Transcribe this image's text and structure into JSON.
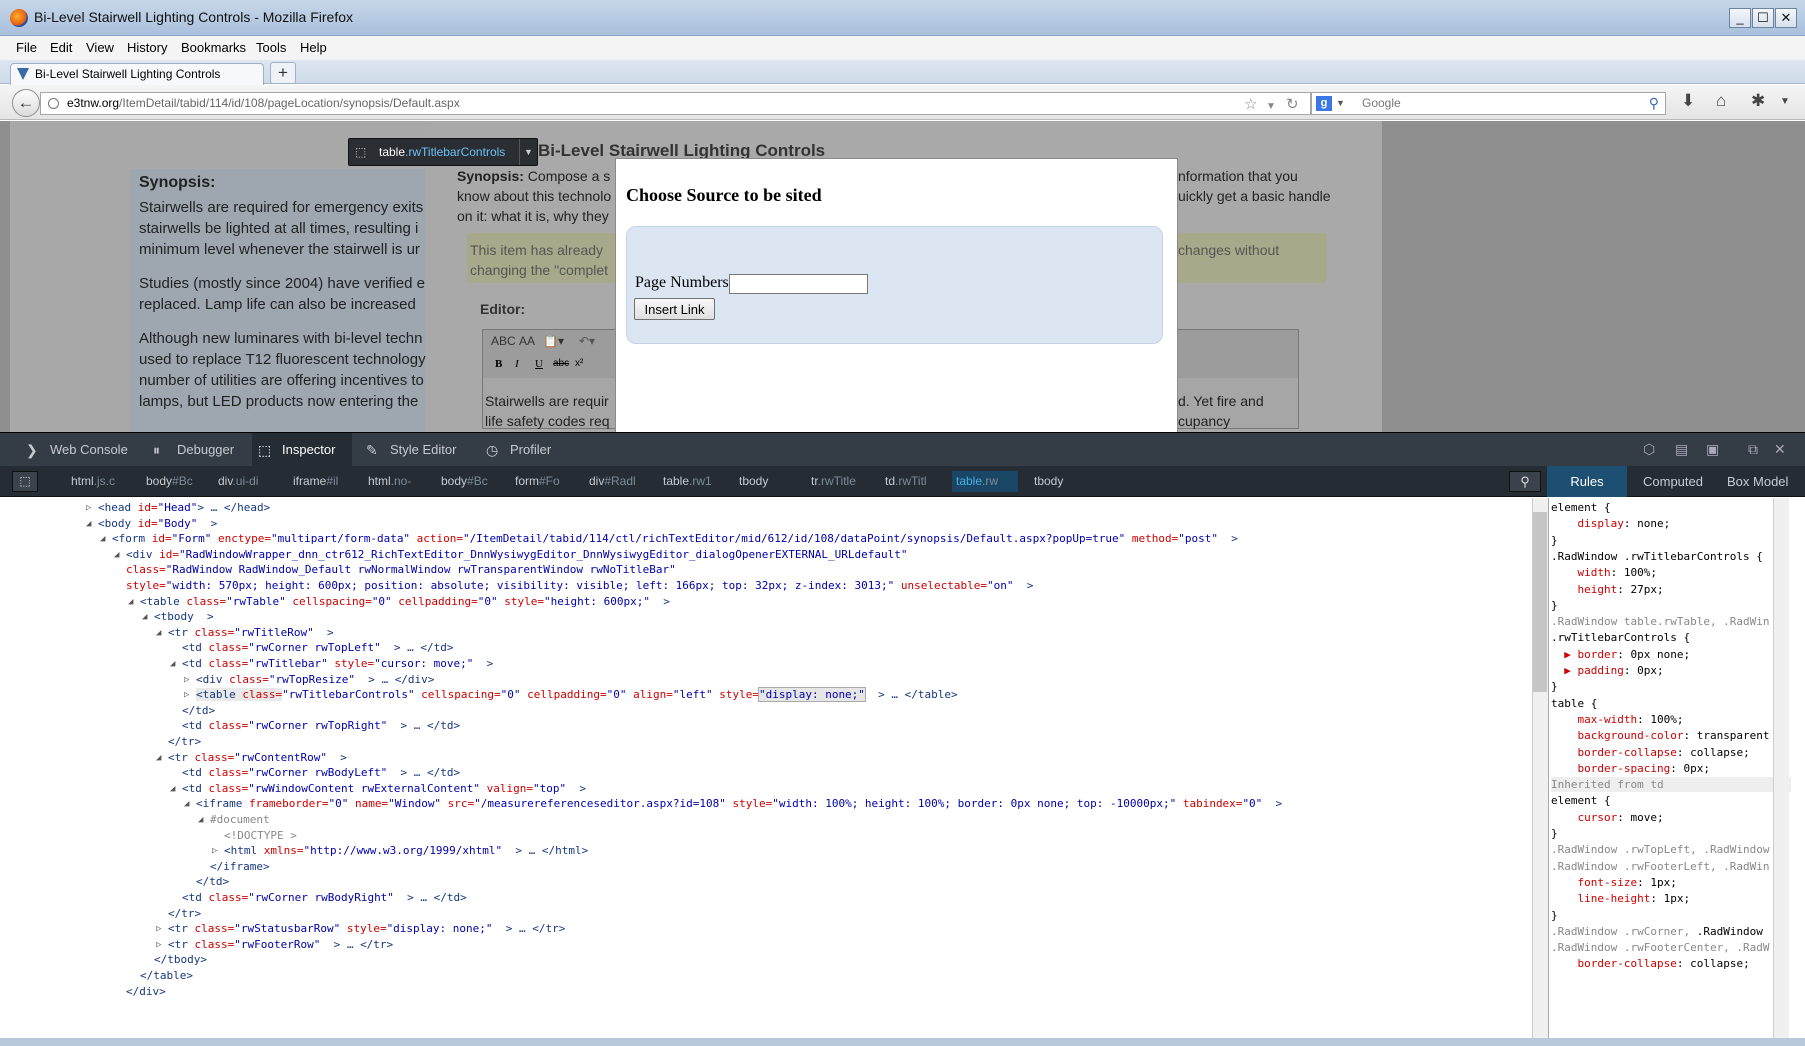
{
  "window": {
    "title": "Bi-Level Stairwell Lighting Controls - Mozilla Firefox",
    "min": "_",
    "max": "☐",
    "close": "✕"
  },
  "menu": [
    "File",
    "Edit",
    "View",
    "History",
    "Bookmarks",
    "Tools",
    "Help"
  ],
  "tab": {
    "label": "Bi-Level Stairwell Lighting Controls",
    "new": "+"
  },
  "nav": {
    "back": "←",
    "url_domain": "e3tnw.org",
    "url_path": "/ItemDetail/tabid/114/id/108/pageLocation/synopsis/Default.aspx",
    "search_placeholder": "Google",
    "star": "☆",
    "reload": "↻"
  },
  "page": {
    "heading": "Bi-Level Stairwell Lighting Controls",
    "left_title": "Synopsis:",
    "left_p1": [
      "Stairwells are required for emergency exits",
      "stairwells be lighted at all times, resulting i",
      "minimum level whenever the stairwell is ur"
    ],
    "left_p2": [
      "Studies (mostly since 2004) have verified e",
      "replaced.  Lamp life can also be increased"
    ],
    "left_p3": [
      "Although new luminares with bi-level techn",
      "used to replace T12 fluorescent technology",
      "number of utilities are offering incentives to",
      "lamps, but LED products now entering the"
    ],
    "synopsis_label": "Synopsis:",
    "right_l1a": "Compose a s",
    "right_l1b": "nformation that you",
    "right_l2a": "know about this technolo",
    "right_l2b": "uickly get a basic handle",
    "right_l3a": "on it: what it is, why they",
    "alert_l1a": "This item has already",
    "alert_l1b": "changes without",
    "alert_l2": "changing the \"complet",
    "editor_label": "Editor:",
    "editor_l1a": "Stairwells are requir",
    "editor_l1b": "d.  Yet fire and",
    "editor_l2a": "life safety codes req",
    "editor_l2b": "cupancy"
  },
  "pill": {
    "tag": "table",
    "cls": ".rwTitlebarControls"
  },
  "dialog": {
    "title": "Choose Source to be sited",
    "field_label": "Page Numbers:",
    "field_value": "",
    "button": "Insert Link"
  },
  "devtools": {
    "tabs": [
      "Web Console",
      "Debugger",
      "Inspector",
      "Style Editor",
      "Profiler"
    ],
    "breadcrumbs": [
      [
        "html",
        ".js.c"
      ],
      [
        "body",
        "#Bc"
      ],
      [
        "div",
        ".ui-di"
      ],
      [
        "iframe",
        "#il"
      ],
      [
        "html",
        ".no-"
      ],
      [
        "body",
        "#Bc"
      ],
      [
        "form",
        "#Fo"
      ],
      [
        "div",
        "#Radl"
      ],
      [
        "table",
        ".rw1"
      ],
      [
        "tbody",
        ""
      ],
      [
        "tr",
        ".rwTitle"
      ],
      [
        "td",
        ".rwTitl"
      ],
      [
        "table",
        ".rw"
      ],
      [
        "tbody",
        ""
      ]
    ],
    "sidebar_tabs": [
      "Rules",
      "Computed",
      "Box Model"
    ]
  },
  "markup": [
    {
      "i": 0,
      "tw": "▷",
      "seg": [
        [
          "tg",
          "<head"
        ],
        [
          "an",
          " id="
        ],
        [
          "av",
          "\"Head\""
        ],
        [
          "tg",
          "> … </head>"
        ]
      ]
    },
    {
      "i": 0,
      "tw": "◢",
      "seg": [
        [
          "tg",
          "<body"
        ],
        [
          "an",
          " id="
        ],
        [
          "av",
          "\"Body\""
        ],
        [
          "tg",
          "  >"
        ]
      ]
    },
    {
      "i": 1,
      "tw": "◢",
      "seg": [
        [
          "tg",
          "<form"
        ],
        [
          "an",
          " id="
        ],
        [
          "av",
          "\"Form\""
        ],
        [
          "an",
          " enctype="
        ],
        [
          "av",
          "\"multipart/form-data\""
        ],
        [
          "an",
          " action="
        ],
        [
          "av",
          "\"/ItemDetail/tabid/114/ctl/richTextEditor/mid/612/id/108/dataPoint/synopsis/Default.aspx?popUp=true\""
        ],
        [
          "an",
          " method="
        ],
        [
          "av",
          "\"post\""
        ],
        [
          "tg",
          "  >"
        ]
      ]
    },
    {
      "i": 2,
      "tw": "◢",
      "seg": [
        [
          "tg",
          "<div"
        ],
        [
          "an",
          " id="
        ],
        [
          "av",
          "\"RadWindowWrapper_dnn_ctr612_RichTextEditor_DnnWysiwygEditor_DnnWysiwygEditor_dialogOpenerEXTERNAL_URLdefault\""
        ]
      ]
    },
    {
      "i": 2,
      "tw": "",
      "seg": [
        [
          "an",
          "class="
        ],
        [
          "av",
          "\"RadWindow RadWindow_Default rwNormalWindow rwTransparentWindow rwNoTitleBar\""
        ]
      ]
    },
    {
      "i": 2,
      "tw": "",
      "seg": [
        [
          "an",
          "style="
        ],
        [
          "av",
          "\"width: 570px; height: 600px; position: absolute; visibility: visible; left: 166px; top: 32px; z-index: 3013;\""
        ],
        [
          "an",
          " unselectable="
        ],
        [
          "av",
          "\"on\""
        ],
        [
          "tg",
          "  >"
        ]
      ]
    },
    {
      "i": 3,
      "tw": "◢",
      "seg": [
        [
          "tg",
          "<table"
        ],
        [
          "an",
          " class="
        ],
        [
          "av",
          "\"rwTable\""
        ],
        [
          "an",
          " cellspacing="
        ],
        [
          "av",
          "\"0\""
        ],
        [
          "an",
          " cellpadding="
        ],
        [
          "av",
          "\"0\""
        ],
        [
          "an",
          " style="
        ],
        [
          "av",
          "\"height: 600px;\""
        ],
        [
          "tg",
          "  >"
        ]
      ]
    },
    {
      "i": 4,
      "tw": "◢",
      "seg": [
        [
          "tg",
          "<tbody  >"
        ]
      ]
    },
    {
      "i": 5,
      "tw": "◢",
      "seg": [
        [
          "tg",
          "<tr"
        ],
        [
          "an",
          " class="
        ],
        [
          "av",
          "\"rwTitleRow\""
        ],
        [
          "tg",
          "  >"
        ]
      ]
    },
    {
      "i": 6,
      "tw": "",
      "seg": [
        [
          "tg",
          "<td"
        ],
        [
          "an",
          " class="
        ],
        [
          "av",
          "\"rwCorner rwTopLeft\""
        ],
        [
          "tg",
          "  > … </td>"
        ]
      ]
    },
    {
      "i": 6,
      "tw": "◢",
      "seg": [
        [
          "tg",
          "<td"
        ],
        [
          "an",
          " class="
        ],
        [
          "av",
          "\"rwTitlebar\""
        ],
        [
          "an",
          " style="
        ],
        [
          "av",
          "\"cursor: move;\""
        ],
        [
          "tg",
          "  >"
        ]
      ]
    },
    {
      "i": 7,
      "tw": "▷",
      "seg": [
        [
          "tg",
          "<div"
        ],
        [
          "an",
          " class="
        ],
        [
          "av",
          "\"rwTopResize\""
        ],
        [
          "tg",
          "  > … </div>"
        ]
      ]
    },
    {
      "i": 7,
      "tw": "▷",
      "hl": true,
      "seg": [
        [
          "tg",
          "<table"
        ],
        [
          "an",
          " class="
        ],
        [
          "av",
          "\"rwTitlebarControls\""
        ],
        [
          "an",
          " cellspacing="
        ],
        [
          "av",
          "\"0\""
        ],
        [
          "an",
          " cellpadding="
        ],
        [
          "av",
          "\"0\""
        ],
        [
          "an",
          " align="
        ],
        [
          "av",
          "\"left\""
        ],
        [
          "an",
          " style="
        ],
        [
          "av",
          "\"display: none;\""
        ],
        [
          "tg",
          "  > … </table>"
        ]
      ]
    },
    {
      "i": 6,
      "tw": "",
      "seg": [
        [
          "tg",
          "</td>"
        ]
      ]
    },
    {
      "i": 6,
      "tw": "",
      "seg": [
        [
          "tg",
          "<td"
        ],
        [
          "an",
          " class="
        ],
        [
          "av",
          "\"rwCorner rwTopRight\""
        ],
        [
          "tg",
          "  > … </td>"
        ]
      ]
    },
    {
      "i": 5,
      "tw": "",
      "seg": [
        [
          "tg",
          "</tr>"
        ]
      ]
    },
    {
      "i": 5,
      "tw": "◢",
      "seg": [
        [
          "tg",
          "<tr"
        ],
        [
          "an",
          " class="
        ],
        [
          "av",
          "\"rwContentRow\""
        ],
        [
          "tg",
          "  >"
        ]
      ]
    },
    {
      "i": 6,
      "tw": "",
      "seg": [
        [
          "tg",
          "<td"
        ],
        [
          "an",
          " class="
        ],
        [
          "av",
          "\"rwCorner rwBodyLeft\""
        ],
        [
          "tg",
          "  > … </td>"
        ]
      ]
    },
    {
      "i": 6,
      "tw": "◢",
      "seg": [
        [
          "tg",
          "<td"
        ],
        [
          "an",
          " class="
        ],
        [
          "av",
          "\"rwWindowContent rwExternalContent\""
        ],
        [
          "an",
          " valign="
        ],
        [
          "av",
          "\"top\""
        ],
        [
          "tg",
          "  >"
        ]
      ]
    },
    {
      "i": 7,
      "tw": "◢",
      "seg": [
        [
          "tg",
          "<iframe"
        ],
        [
          "an",
          " frameborder="
        ],
        [
          "av",
          "\"0\""
        ],
        [
          "an",
          " name="
        ],
        [
          "av",
          "\"Window\""
        ],
        [
          "an",
          " src="
        ],
        [
          "av",
          "\"/measurereferenceseditor.aspx?id=108\""
        ],
        [
          "an",
          " style="
        ],
        [
          "av",
          "\"width: 100%; height: 100%; border: 0px none; top: -10000px;\""
        ],
        [
          "an",
          " tabindex="
        ],
        [
          "av",
          "\"0\""
        ],
        [
          "tg",
          "  >"
        ]
      ]
    },
    {
      "i": 8,
      "tw": "◢",
      "seg": [
        [
          "inh",
          "#document"
        ]
      ]
    },
    {
      "i": 9,
      "tw": "",
      "seg": [
        [
          "inh",
          "<!DOCTYPE >"
        ]
      ]
    },
    {
      "i": 9,
      "tw": "▷",
      "seg": [
        [
          "tg",
          "<html"
        ],
        [
          "an",
          " xmlns="
        ],
        [
          "av",
          "\"http://www.w3.org/1999/xhtml\""
        ],
        [
          "tg",
          "  > … </html>"
        ]
      ]
    },
    {
      "i": 8,
      "tw": "",
      "seg": [
        [
          "tg",
          "</iframe>"
        ]
      ]
    },
    {
      "i": 7,
      "tw": "",
      "seg": [
        [
          "tg",
          "</td>"
        ]
      ]
    },
    {
      "i": 6,
      "tw": "",
      "seg": [
        [
          "tg",
          "<td"
        ],
        [
          "an",
          " class="
        ],
        [
          "av",
          "\"rwCorner rwBodyRight\""
        ],
        [
          "tg",
          "  > … </td>"
        ]
      ]
    },
    {
      "i": 5,
      "tw": "",
      "seg": [
        [
          "tg",
          "</tr>"
        ]
      ]
    },
    {
      "i": 5,
      "tw": "▷",
      "seg": [
        [
          "tg",
          "<tr"
        ],
        [
          "an",
          " class="
        ],
        [
          "av",
          "\"rwStatusbarRow\""
        ],
        [
          "an",
          " style="
        ],
        [
          "av",
          "\"display: none;\""
        ],
        [
          "tg",
          "  > … </tr>"
        ]
      ]
    },
    {
      "i": 5,
      "tw": "▷",
      "seg": [
        [
          "tg",
          "<tr"
        ],
        [
          "an",
          " class="
        ],
        [
          "av",
          "\"rwFooterRow\""
        ],
        [
          "tg",
          "  > … </tr>"
        ]
      ]
    },
    {
      "i": 4,
      "tw": "",
      "seg": [
        [
          "tg",
          "</tbody>"
        ]
      ]
    },
    {
      "i": 3,
      "tw": "",
      "seg": [
        [
          "tg",
          "</table>"
        ]
      ]
    },
    {
      "i": 2,
      "tw": "",
      "seg": [
        [
          "tg",
          "</div>"
        ]
      ]
    }
  ],
  "rules": [
    [
      [
        "sel-c",
        "element {"
      ]
    ],
    [
      [
        "pn",
        "    display"
      ],
      [
        "pv",
        ": none;"
      ]
    ],
    [
      [
        "sel-c",
        "}"
      ]
    ],
    [
      [
        "sel-c",
        ".RadWindow .rwTitlebarControls {"
      ]
    ],
    [
      [
        "pn",
        "    width"
      ],
      [
        "pv",
        ": 100%;"
      ]
    ],
    [
      [
        "pn",
        "    height"
      ],
      [
        "pv",
        ": 27px;"
      ]
    ],
    [
      [
        "sel-c",
        "}"
      ]
    ],
    [
      [
        "inh",
        ".RadWindow table.rwTable, .RadWin"
      ]
    ],
    [
      [
        "sel-c",
        ".rwTitlebarControls {"
      ]
    ],
    [
      [
        "pn",
        "  ▶ border"
      ],
      [
        "pv",
        ": 0px none;"
      ]
    ],
    [
      [
        "pn",
        "  ▶ padding"
      ],
      [
        "pv",
        ": 0px;"
      ]
    ],
    [
      [
        "sel-c",
        "}"
      ]
    ],
    [
      [
        "sel-c",
        "table {"
      ]
    ],
    [
      [
        "pn",
        "    max-width"
      ],
      [
        "pv",
        ": 100%;"
      ]
    ],
    [
      [
        "pn",
        "    background-color"
      ],
      [
        "pv",
        ": transparent"
      ]
    ],
    [
      [
        "pn",
        "    border-collapse"
      ],
      [
        "pv",
        ": collapse;"
      ]
    ],
    [
      [
        "pn",
        "    border-spacing"
      ],
      [
        "pv",
        ": 0px;"
      ]
    ],
    [
      [
        "inh",
        "Inherited from td"
      ]
    ],
    [
      [
        "sel-c",
        "element {"
      ]
    ],
    [
      [
        "pn",
        "    cursor"
      ],
      [
        "pv",
        ": move;"
      ]
    ],
    [
      [
        "sel-c",
        "}"
      ]
    ],
    [
      [
        "inh",
        ".RadWindow .rwTopLeft, .RadWindow"
      ]
    ],
    [
      [
        "inh",
        ".RadWindow .rwFooterLeft, .RadWin"
      ]
    ],
    [
      [
        "pn",
        "    font-size"
      ],
      [
        "pv",
        ": 1px;"
      ]
    ],
    [
      [
        "pn",
        "    line-height"
      ],
      [
        "pv",
        ": 1px;"
      ]
    ],
    [
      [
        "sel-c",
        "}"
      ]
    ],
    [
      [
        "inh",
        ".RadWindow .rwCorner, "
      ],
      [
        "sel-c",
        ".RadWindow"
      ]
    ],
    [
      [
        "inh",
        ".RadWindow .rwFooterCenter, .RadW"
      ]
    ],
    [
      [
        "pn",
        "    border-collapse"
      ],
      [
        "pv",
        ": collapse;"
      ]
    ]
  ]
}
